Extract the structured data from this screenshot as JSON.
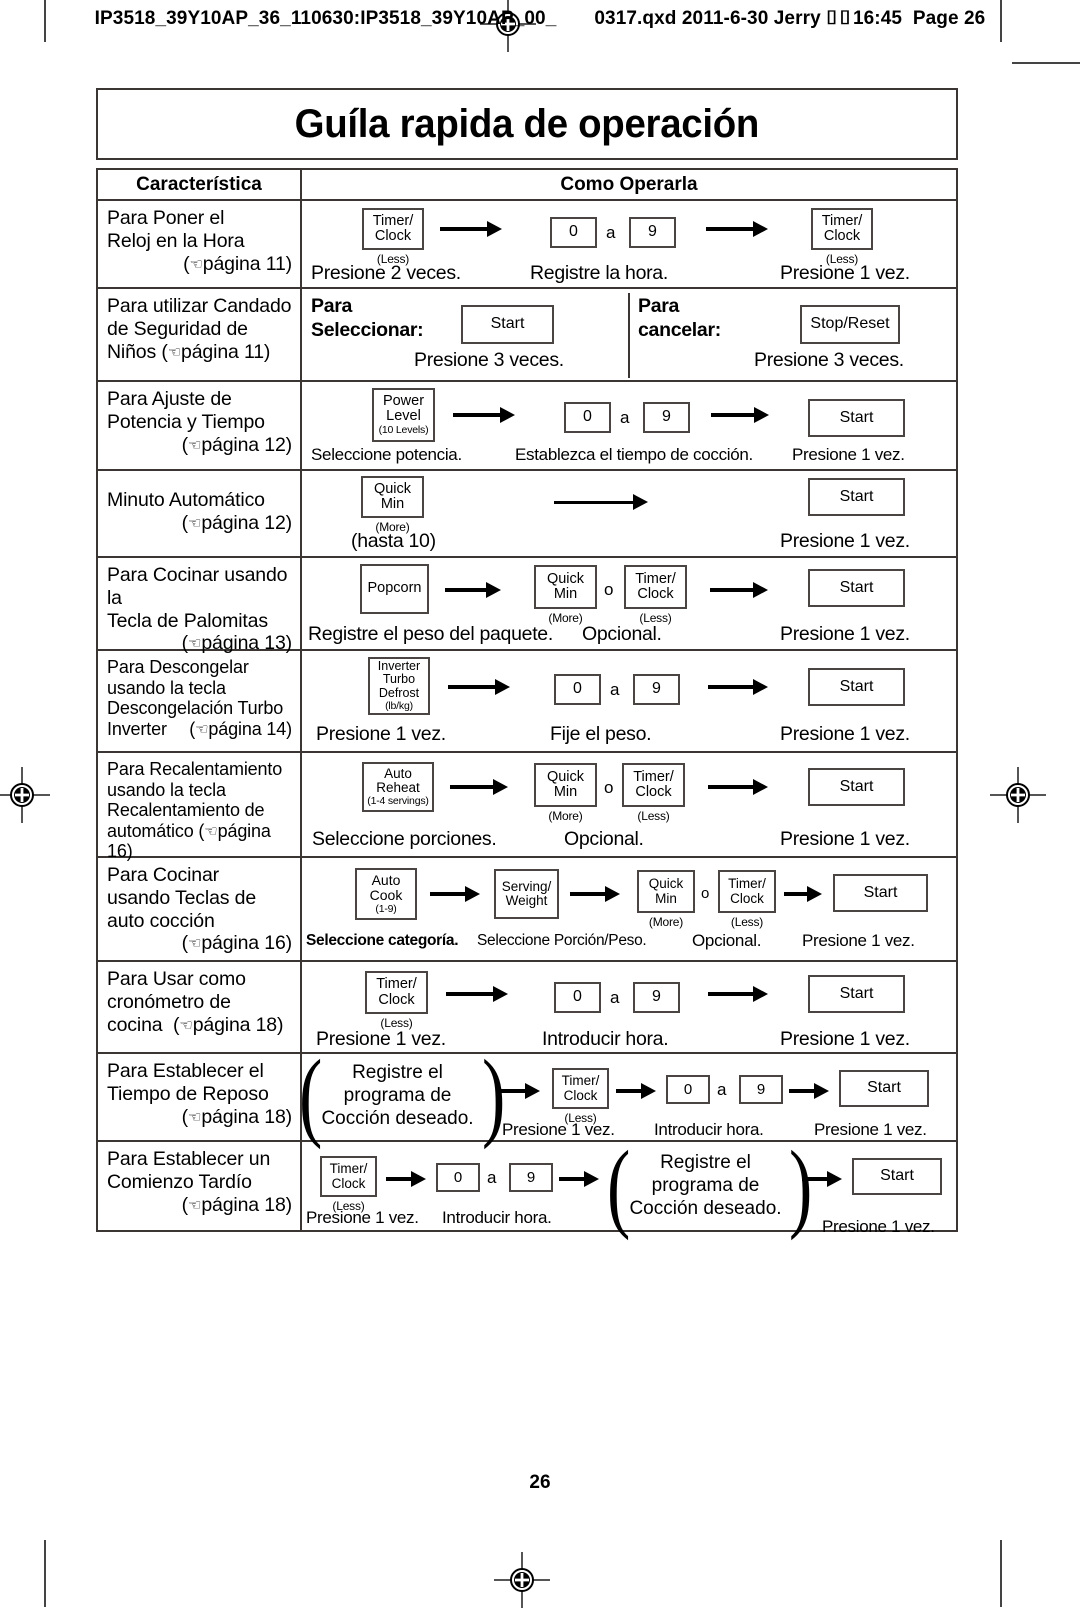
{
  "slug": {
    "text_before": "IP3518_39Y10AP_36_110630:IP3518_39Y10AP_00_",
    "text_after": "0317.qxd  2011-6-30  Jerry",
    "box_glyphs": "⌷⌷",
    "time": "16:45",
    "page_label": "Page 26"
  },
  "title": "Guíla rapida de operación",
  "table": {
    "headers": {
      "feature": "Característica",
      "operation": "Como Operarla"
    },
    "rows": [
      {
        "feature_lines": [
          "Para Poner el",
          "Reloj en la Hora"
        ],
        "page_ref": "página 11",
        "keys": [
          {
            "label_top": "Timer/",
            "label_bottom": "Clock",
            "sub_below": "(Less)"
          },
          {
            "label_top": "0"
          },
          {
            "label_top": "9"
          },
          {
            "label_top": "Timer/",
            "label_bottom": "Clock",
            "sub_below": "(Less)"
          }
        ],
        "between_word": "a",
        "captions": [
          "Presione 2 veces.",
          "Registre la hora.",
          "Presione 1 vez."
        ]
      },
      {
        "feature_lines": [
          "Para utilizar Candado",
          "de Seguridad de",
          "Niños"
        ],
        "page_ref": "página 11",
        "select_label_lines": [
          "Para",
          "Seleccionar:"
        ],
        "cancel_label_lines": [
          "Para",
          "cancelar:"
        ],
        "select_key": "Start",
        "cancel_key": "Stop/Reset",
        "captions": [
          "Presione 3 veces.",
          "Presione 3 veces."
        ]
      },
      {
        "feature_lines": [
          "Para Ajuste de",
          "Potencia y Tiempo"
        ],
        "page_ref": "página 12",
        "keys": [
          {
            "label_top": "Power",
            "label_bottom": "Level",
            "sub_inline": "(10 Levels)"
          },
          {
            "label_top": "0"
          },
          {
            "label_top": "9"
          },
          {
            "label_top": "Start"
          }
        ],
        "between_word": "a",
        "captions": [
          "Seleccione potencia.",
          "Establezca el tiempo de cocción.",
          "Presione 1 vez."
        ]
      },
      {
        "feature_lines": [
          "Minuto Automático"
        ],
        "page_ref": "página 12",
        "keys": [
          {
            "label_top": "Quick",
            "label_bottom": "Min",
            "sub_below": "(More)"
          },
          {
            "label_top": "Start"
          }
        ],
        "captions": [
          "(hasta 10)",
          "Presione 1 vez."
        ]
      },
      {
        "feature_lines": [
          "Para Cocinar usando la",
          "Tecla de Palomitas"
        ],
        "page_ref": "página 13",
        "keys": [
          {
            "label_top": "Popcorn"
          },
          {
            "label_top": "Quick",
            "label_bottom": "Min",
            "sub_below": "(More)"
          },
          {
            "label_top": "Timer/",
            "label_bottom": "Clock",
            "sub_below": "(Less)"
          },
          {
            "label_top": "Start"
          }
        ],
        "between_word": "o",
        "captions": [
          "Registre el peso del paquete.",
          "Opcional.",
          "Presione 1 vez."
        ]
      },
      {
        "feature_lines": [
          "Para Descongelar",
          "usando la tecla",
          "Descongelación Turbo",
          "Inverter"
        ],
        "page_ref": "página 14",
        "keys": [
          {
            "label_top": "Inverter",
            "label_mid": "Turbo",
            "label_bottom": "Defrost",
            "sub_inline": "(lb/kg)"
          },
          {
            "label_top": "0"
          },
          {
            "label_top": "9"
          },
          {
            "label_top": "Start"
          }
        ],
        "between_word": "a",
        "captions": [
          "Presione 1 vez.",
          "Fije el peso.",
          "Presione 1 vez."
        ]
      },
      {
        "feature_lines": [
          "Para Recalentamiento",
          "usando la tecla",
          "Recalentamiento de",
          "automático"
        ],
        "page_ref": "página 16",
        "keys": [
          {
            "label_top": "Auto",
            "label_bottom": "Reheat",
            "sub_inline": "(1-4 servings)"
          },
          {
            "label_top": "Quick",
            "label_bottom": "Min",
            "sub_below": "(More)"
          },
          {
            "label_top": "Timer/",
            "label_bottom": "Clock",
            "sub_below": "(Less)"
          },
          {
            "label_top": "Start"
          }
        ],
        "between_word": "o",
        "captions": [
          "Seleccione porciones.",
          "Opcional.",
          "Presione 1 vez."
        ]
      },
      {
        "feature_lines": [
          "Para Cocinar",
          "usando Teclas de",
          "auto cocción"
        ],
        "page_ref": "página 16",
        "keys": [
          {
            "label_top": "Auto",
            "label_bottom": "Cook",
            "sub_inline": "(1-9)"
          },
          {
            "label_top": "Serving/",
            "label_bottom": "Weight"
          },
          {
            "label_top": "Quick",
            "label_bottom": "Min",
            "sub_below": "(More)"
          },
          {
            "label_top": "Timer/",
            "label_bottom": "Clock",
            "sub_below": "(Less)"
          },
          {
            "label_top": "Start"
          }
        ],
        "between_word": "o",
        "captions": [
          "Seleccione categoría.",
          "Seleccione Porción/Peso.",
          "Opcional.",
          "Presione 1 vez."
        ]
      },
      {
        "feature_lines": [
          "Para Usar como",
          "cronómetro de",
          "cocina"
        ],
        "page_ref": "página 18",
        "keys": [
          {
            "label_top": "Timer/",
            "label_bottom": "Clock",
            "sub_below": "(Less)"
          },
          {
            "label_top": "0"
          },
          {
            "label_top": "9"
          },
          {
            "label_top": "Start"
          }
        ],
        "between_word": "a",
        "captions": [
          "Presione 1 vez.",
          "Introducir hora.",
          "Presione 1 vez."
        ]
      },
      {
        "feature_lines": [
          "Para Establecer el",
          "Tiempo de Reposo"
        ],
        "page_ref": "página 18",
        "paren_lines": [
          "Registre el",
          "programa de",
          "Cocción deseado."
        ],
        "keys": [
          {
            "label_top": "Timer/",
            "label_bottom": "Clock",
            "sub_below": "(Less)"
          },
          {
            "label_top": "0"
          },
          {
            "label_top": "9"
          },
          {
            "label_top": "Start"
          }
        ],
        "between_word": "a",
        "captions": [
          "Presione 1 vez.",
          "Introducir hora.",
          "Presione 1 vez."
        ]
      },
      {
        "feature_lines": [
          "Para Establecer un",
          "Comienzo Tardío"
        ],
        "page_ref": "página 18",
        "paren_lines": [
          "Registre el",
          "programa de",
          "Cocción deseado."
        ],
        "keys": [
          {
            "label_top": "Timer/",
            "label_bottom": "Clock",
            "sub_below": "(Less)"
          },
          {
            "label_top": "0"
          },
          {
            "label_top": "9"
          },
          {
            "label_top": "Start"
          }
        ],
        "between_word": "a",
        "captions": [
          "Presione 1 vez.",
          "Introducir hora.",
          "Presione 1 vez."
        ]
      }
    ]
  },
  "folio": "26"
}
